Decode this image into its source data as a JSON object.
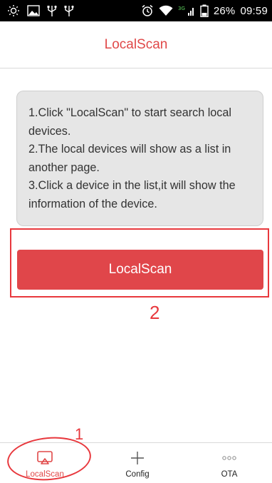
{
  "status_bar": {
    "network": "3G",
    "battery": "26%",
    "time": "09:59"
  },
  "header": {
    "title": "LocalScan"
  },
  "info_card": {
    "lines": [
      "1.Click \"LocalScan\" to start search local",
      "devices.",
      "2.The local devices will show as a list in",
      "another page.",
      "3.Click a device in the list,it will show the",
      "information of the device."
    ]
  },
  "scan_button": {
    "label": "LocalScan"
  },
  "annotations": {
    "one": "1",
    "two": "2"
  },
  "bottom_nav": {
    "items": [
      {
        "label": "LocalScan",
        "icon": "airplay-icon",
        "active": true
      },
      {
        "label": "Config",
        "icon": "plus-icon",
        "active": false
      },
      {
        "label": "OTA",
        "icon": "more-dots-icon",
        "active": false
      }
    ]
  },
  "colors": {
    "accent": "#e04848",
    "annotation": "#e8383d",
    "card_bg": "#e6e6e6",
    "status_bar": "#000000"
  }
}
